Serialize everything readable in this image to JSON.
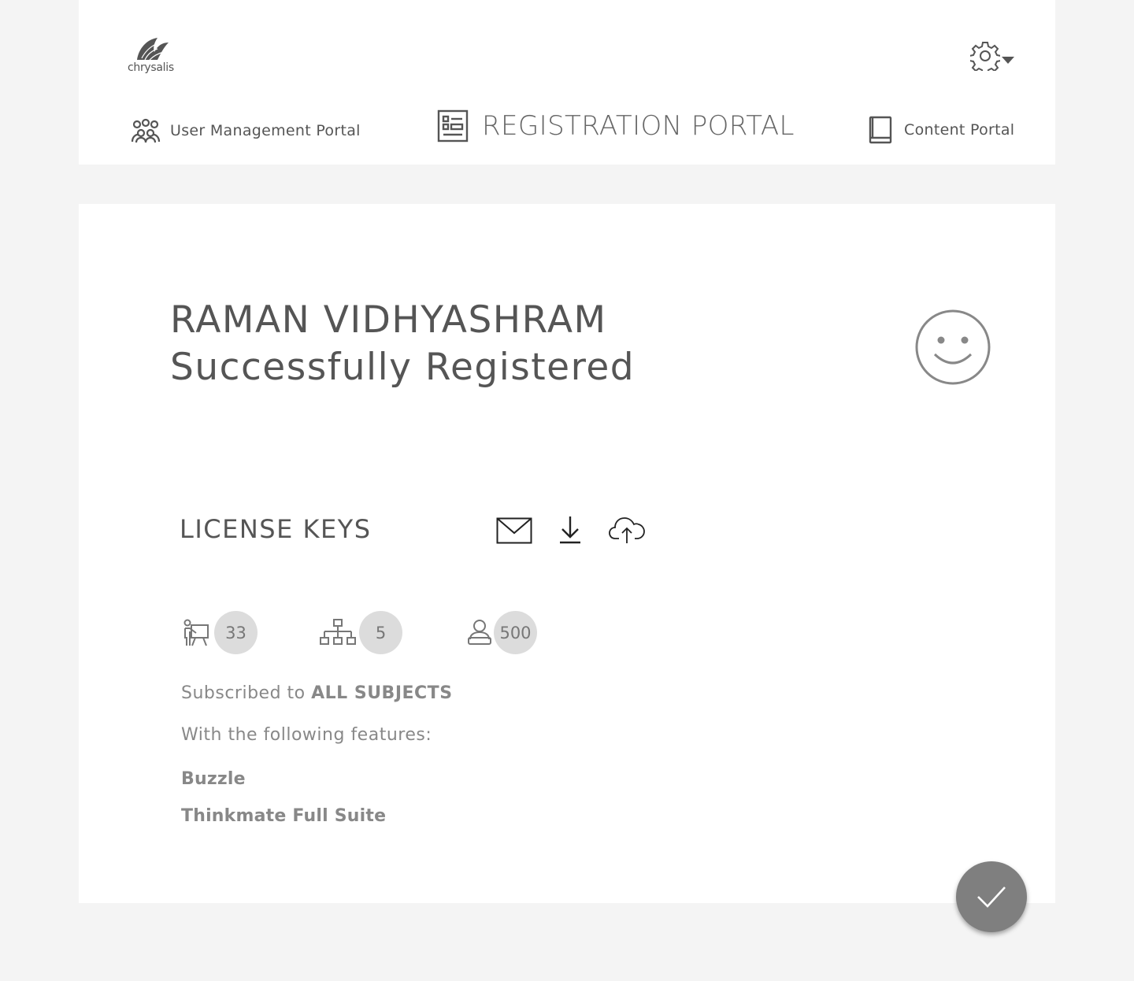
{
  "header": {
    "logo_text": "chrysalis",
    "nav": {
      "user_management": "User Management Portal",
      "registration": "REGISTRATION PORTAL",
      "content": "Content Portal"
    }
  },
  "registration": {
    "school_name": "RAMAN VIDHYASHRAM",
    "status_message": "Successfully Registered"
  },
  "license": {
    "title": "LICENSE KEYS",
    "stats": [
      {
        "icon": "teacher-icon",
        "count": "33"
      },
      {
        "icon": "hierarchy-icon",
        "count": "5"
      },
      {
        "icon": "student-icon",
        "count": "500"
      }
    ],
    "subscription_prefix": "Subscribed to ",
    "subscription_value": "ALL SUBJECTS",
    "features_intro": "With the following features:",
    "features": [
      "Buzzle",
      "Thinkmate Full Suite"
    ]
  },
  "colors": {
    "background": "#f4f4f4",
    "text": "#555555",
    "badge": "#dcdcdc",
    "fab": "#7f7f7f"
  }
}
